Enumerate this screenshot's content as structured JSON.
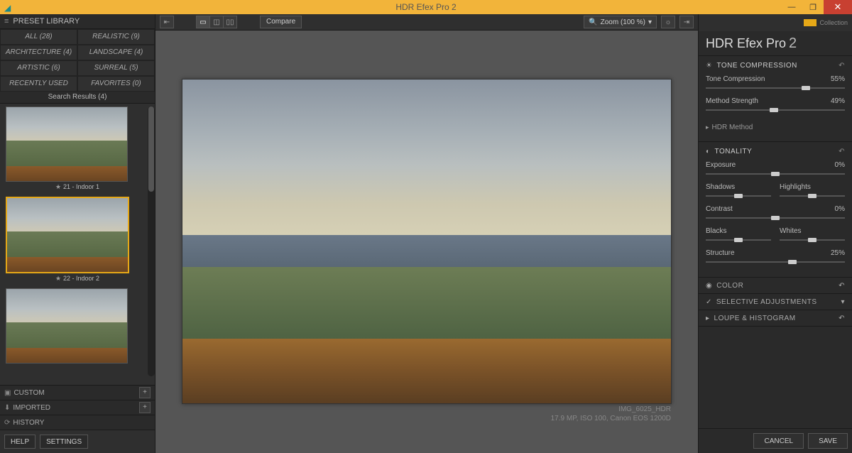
{
  "window": {
    "title": "HDR Efex Pro 2"
  },
  "brand": {
    "collection": "Collection"
  },
  "product": {
    "name": "HDR Efex Pro ",
    "version": "2"
  },
  "library": {
    "header": "PRESET LIBRARY",
    "categories": [
      "ALL  (28)",
      "REALISTIC  (9)",
      "ARCHITECTURE  (4)",
      "LANDSCAPE  (4)",
      "ARTISTIC  (6)",
      "SURREAL  (5)",
      "RECENTLY USED",
      "FAVORITES  (0)"
    ],
    "results_header": "Search Results (4)",
    "presets": [
      {
        "label": "21 - Indoor 1"
      },
      {
        "label": "22 - Indoor 2"
      },
      {
        "label": ""
      }
    ],
    "custom": "CUSTOM",
    "imported": "IMPORTED",
    "history": "HISTORY",
    "help": "HELP",
    "settings": "SETTINGS"
  },
  "toolbar": {
    "compare": "Compare",
    "zoom": "Zoom (100 %)"
  },
  "image": {
    "filename": "IMG_6025_HDR",
    "meta": "17.9 MP, ISO 100, Canon EOS 1200D"
  },
  "panels": {
    "tone": {
      "title": "TONE COMPRESSION",
      "compression": {
        "label": "Tone Compression",
        "value": "55%",
        "pos": 72
      },
      "strength": {
        "label": "Method Strength",
        "value": "49%",
        "pos": 49
      },
      "method": "HDR Method"
    },
    "tonality": {
      "title": "TONALITY",
      "exposure": {
        "label": "Exposure",
        "value": "0%",
        "pos": 50
      },
      "shadows": "Shadows",
      "highlights": "Highlights",
      "contrast": {
        "label": "Contrast",
        "value": "0%",
        "pos": 50
      },
      "blacks": "Blacks",
      "whites": "Whites",
      "structure": {
        "label": "Structure",
        "value": "25%",
        "pos": 62
      }
    },
    "color": {
      "title": "COLOR"
    },
    "selective": {
      "title": "SELECTIVE ADJUSTMENTS"
    },
    "loupe": {
      "title": "LOUPE & HISTOGRAM"
    }
  },
  "footer": {
    "cancel": "CANCEL",
    "save": "SAVE"
  }
}
